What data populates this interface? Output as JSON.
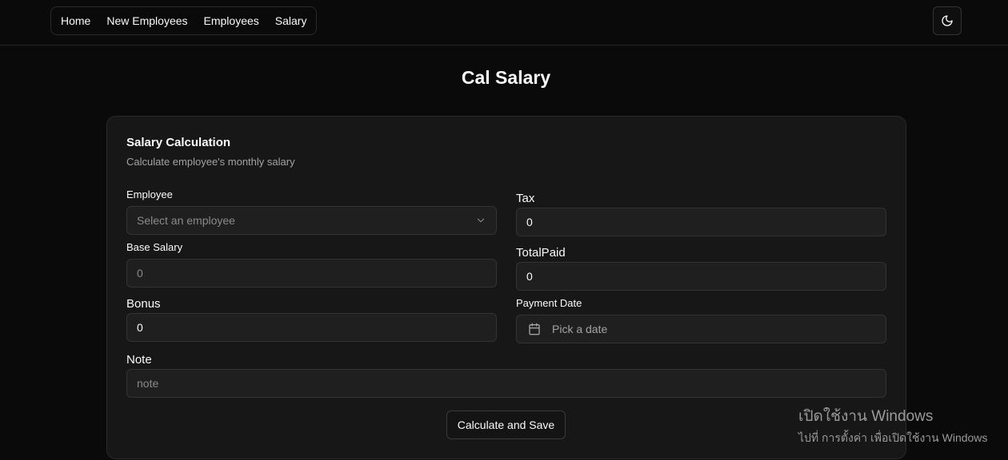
{
  "nav": {
    "items": [
      {
        "label": "Home"
      },
      {
        "label": "New Employees"
      },
      {
        "label": "Employees"
      },
      {
        "label": "Salary"
      }
    ],
    "theme_icon": "moon-icon"
  },
  "page": {
    "title": "Cal Salary"
  },
  "card": {
    "title": "Salary Calculation",
    "description": "Calculate employee's monthly salary"
  },
  "form": {
    "employee": {
      "label": "Employee",
      "placeholder": "Select an employee",
      "icon": "chevron-down-icon"
    },
    "base_salary": {
      "label": "Base Salary",
      "value": "0"
    },
    "bonus": {
      "label": "Bonus",
      "value": "0"
    },
    "tax": {
      "label": "Tax",
      "value": "0"
    },
    "total_paid": {
      "label": "TotalPaid",
      "value": "0"
    },
    "payment_date": {
      "label": "Payment Date",
      "placeholder": "Pick a date",
      "icon": "calendar-icon"
    },
    "note": {
      "label": "Note",
      "placeholder": "note"
    },
    "submit_label": "Calculate and Save"
  },
  "watermark": {
    "line1": "เปิดใช้งาน Windows",
    "line2": "ไปที่ การตั้งค่า เพื่อเปิดใช้งาน Windows"
  }
}
